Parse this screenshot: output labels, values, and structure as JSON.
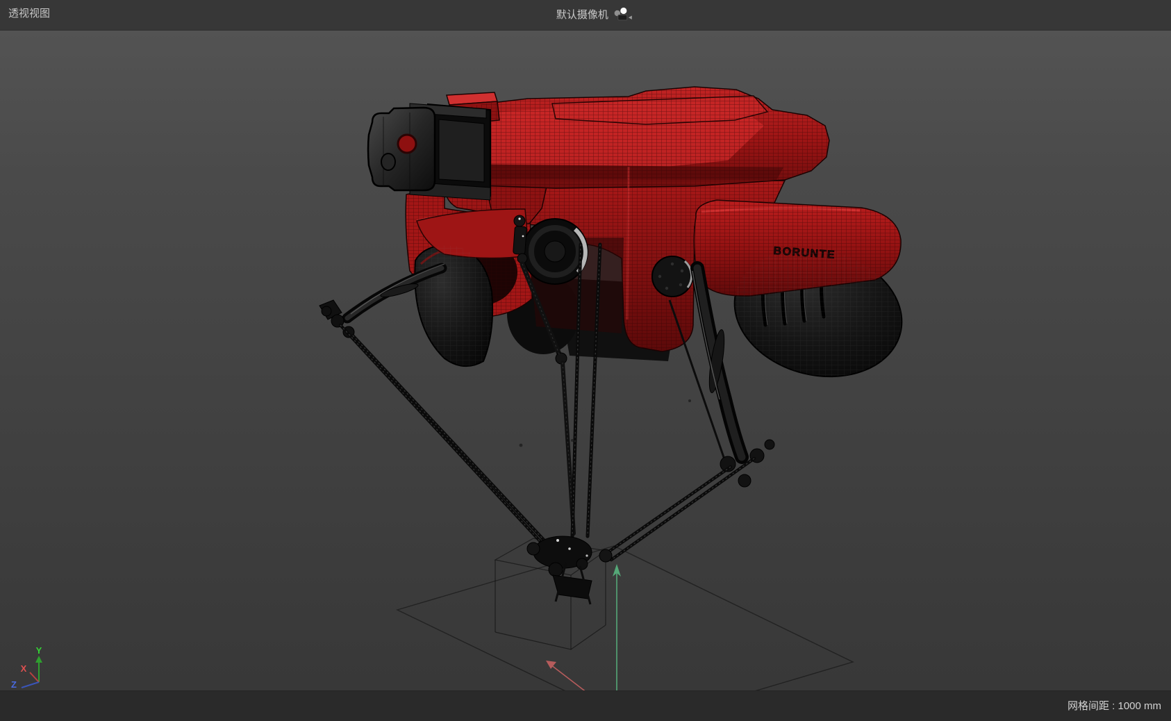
{
  "top_bar": {
    "view_label": "透视视图",
    "camera_label": "默认摄像机"
  },
  "status_bar": {
    "grid_spacing_label": "网格间距 : 1000 mm",
    "grid_spacing_mm": 1000
  },
  "axis_gizmo": {
    "y_label": "Y",
    "x_label": "X",
    "z_label": "Z"
  },
  "model": {
    "brand_label": "BORUNTE",
    "type": "delta-parallel-robot"
  },
  "colors": {
    "top_bar_bg": "#373737",
    "status_bar_bg": "#2a2a2a",
    "viewport_bg_top": "#535353",
    "viewport_bg_bottom": "#383838",
    "robot_red": "#a81818",
    "robot_red_bright": "#c92626",
    "robot_black": "#0f0f0f",
    "axis_y_green": "#55a878",
    "axis_x_red": "#b65c5c",
    "axis_z_blue": "#3c5fae",
    "gizmo_y": "#3fd43f",
    "gizmo_x": "#e05050",
    "gizmo_z": "#4a6ae0"
  }
}
